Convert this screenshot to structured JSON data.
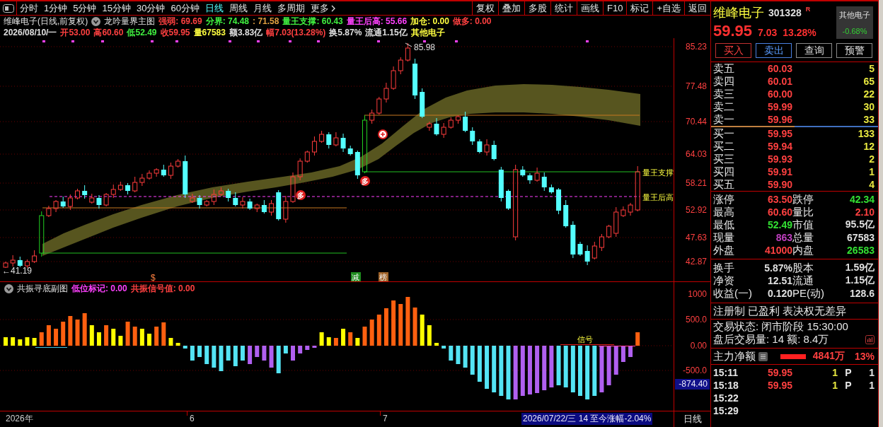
{
  "toolbar": {
    "periods": [
      {
        "label": "分时",
        "selected": false,
        "kind": "period"
      },
      {
        "label": "1分钟",
        "selected": false,
        "kind": "period"
      },
      {
        "label": "5分钟",
        "selected": false,
        "kind": "period"
      },
      {
        "label": "15分钟",
        "selected": false,
        "kind": "period"
      },
      {
        "label": "30分钟",
        "selected": false,
        "kind": "period"
      },
      {
        "label": "60分钟",
        "selected": false,
        "kind": "period"
      },
      {
        "label": "日线",
        "selected": true,
        "kind": "period"
      },
      {
        "label": "周线",
        "selected": false,
        "kind": "period"
      },
      {
        "label": "月线",
        "selected": false,
        "kind": "period"
      },
      {
        "label": "多周期",
        "selected": false,
        "kind": "period"
      },
      {
        "label": "更多",
        "selected": false,
        "kind": "menu"
      }
    ],
    "actions": [
      "复权",
      "叠加",
      "多股",
      "统计",
      "画线",
      "F10",
      "标记",
      "+自选",
      "返回"
    ]
  },
  "main_chart": {
    "title": "维峰电子(日线,前复权)",
    "indicator": "龙吟量界主图",
    "legend": [
      {
        "text": "强弱: 69.69",
        "color": "#ff4040"
      },
      {
        "text": "分界: 74.48",
        "color": "#40f040"
      },
      {
        "text": ": 71.58",
        "color": "#e0a040"
      },
      {
        "text": "量王支撑: 60.43",
        "color": "#40f040"
      },
      {
        "text": "量王后高: 55.66",
        "color": "#ff40ff"
      },
      {
        "text": "加仓: 0.00",
        "color": "#ffff40"
      },
      {
        "text": "做多: 0.00",
        "color": "#ff4040"
      }
    ],
    "quote": [
      {
        "text": "2026/08/10/一",
        "color": "#e0e0e0"
      },
      {
        "text": "开53.00",
        "color": "#ff4040"
      },
      {
        "text": "高60.60",
        "color": "#ff4040"
      },
      {
        "text": "低52.49",
        "color": "#40f040"
      },
      {
        "text": "收59.95",
        "color": "#ff4040"
      },
      {
        "text": "量67583",
        "color": "#ffff40"
      },
      {
        "text": "额3.83亿",
        "color": "#e0e0e0"
      },
      {
        "text": "幅7.03(13.28%)",
        "color": "#ff4040"
      },
      {
        "text": "换5.87%",
        "color": "#e0e0e0"
      },
      {
        "text": "流通1.15亿",
        "color": "#e0e0e0"
      },
      {
        "text": "其他电子",
        "color": "#ffff40"
      }
    ],
    "price_ticks": [
      "85.23",
      "77.48",
      "70.44",
      "64.03",
      "58.21",
      "52.92",
      "47.63",
      "42.87"
    ],
    "peak_label": "85.98",
    "low_label": "←41.19",
    "line_labels": [
      "量王支撑",
      "量王后高"
    ],
    "signal_badges": [
      "多",
      "多"
    ],
    "events": [
      {
        "label": "$",
        "kind": "plain",
        "color": "#ff8040"
      },
      {
        "label": "减",
        "kind": "tag",
        "color": "#1e8c1e"
      },
      {
        "label": "榜",
        "kind": "tag",
        "color": "#a0642a"
      }
    ]
  },
  "sub_chart": {
    "indicator": "共振寻底副图",
    "legend": [
      {
        "text": "低位标记: 0.00",
        "color": "#ff40ff"
      },
      {
        "text": "共振信号值: 0.00",
        "color": "#ff4040"
      }
    ],
    "signal_label": "信号",
    "ticks": [
      "1000",
      "500.0",
      "0.00",
      "-500.0"
    ],
    "current_value": "-874.40"
  },
  "date_axis": {
    "labels": [
      "2026年",
      "6",
      "7"
    ],
    "cursor_info": "2026/07/22/三 14 至今涨幅-2.04%",
    "period": "日线"
  },
  "quote_panel": {
    "name": "维峰电子",
    "code": "301328",
    "flag": "R",
    "sector": {
      "name": "其他电子",
      "change": "-0.68%"
    },
    "price": "59.95",
    "change": "7.03",
    "change_pct": "13.28%",
    "actions": [
      {
        "label": "买入",
        "kind": "buy"
      },
      {
        "label": "卖出",
        "kind": "sell"
      },
      {
        "label": "查询",
        "kind": "plain"
      },
      {
        "label": "预警",
        "kind": "plain"
      }
    ],
    "asks": [
      {
        "label": "卖五",
        "price": "60.03",
        "volume": "5"
      },
      {
        "label": "卖四",
        "price": "60.01",
        "volume": "65"
      },
      {
        "label": "卖三",
        "price": "60.00",
        "volume": "22"
      },
      {
        "label": "卖二",
        "price": "59.99",
        "volume": "30"
      },
      {
        "label": "卖一",
        "price": "59.96",
        "volume": "33"
      }
    ],
    "bids": [
      {
        "label": "买一",
        "price": "59.95",
        "volume": "133"
      },
      {
        "label": "买二",
        "price": "59.94",
        "volume": "12"
      },
      {
        "label": "买三",
        "price": "59.93",
        "volume": "2"
      },
      {
        "label": "买四",
        "price": "59.91",
        "volume": "1"
      },
      {
        "label": "买五",
        "price": "59.90",
        "volume": "4"
      }
    ],
    "stats": [
      {
        "label": "涨停",
        "value": "63.50",
        "color": "#ff4040"
      },
      {
        "label": "跌停",
        "value": "42.34",
        "color": "#33e033"
      },
      {
        "label": "最高",
        "value": "60.60",
        "color": "#ff4040"
      },
      {
        "label": "量比",
        "value": "2.10",
        "color": "#ff4040"
      },
      {
        "label": "最低",
        "value": "52.49",
        "color": "#33e033"
      },
      {
        "label": "市值",
        "value": "95.5亿",
        "color": "#e0e0e0"
      },
      {
        "label": "现量",
        "value": "863",
        "color": "#c040c0"
      },
      {
        "label": "总量",
        "value": "67583",
        "color": "#e0e0e0"
      },
      {
        "label": "外盘",
        "value": "41000",
        "color": "#ff4040"
      },
      {
        "label": "内盘",
        "value": "26583",
        "color": "#33e033"
      }
    ],
    "fundamentals": [
      {
        "label": "换手",
        "value": "5.87%"
      },
      {
        "label": "股本",
        "value": "1.59亿"
      },
      {
        "label": "净资",
        "value": "12.51"
      },
      {
        "label": "流通",
        "value": "1.15亿"
      },
      {
        "label": "收益(一)",
        "value": "0.120"
      },
      {
        "label": "PE(动)",
        "value": "128.6"
      }
    ],
    "tags": "注册制 已盈利 表决权无差异",
    "status": "交易状态: 闭市阶段 15:30:00",
    "after_hours": "盘后交易量: 14  额: 8.4万",
    "main_net": {
      "label": "主力净额",
      "amount": "4841万",
      "ratio": "13%"
    },
    "ticks": [
      {
        "time": "15:11",
        "price": "59.95",
        "volume": "1",
        "side": "P",
        "count": "1"
      },
      {
        "time": "15:18",
        "price": "59.95",
        "volume": "1",
        "side": "P",
        "count": "1"
      },
      {
        "time": "15:22"
      },
      {
        "time": "15:29"
      }
    ]
  }
}
